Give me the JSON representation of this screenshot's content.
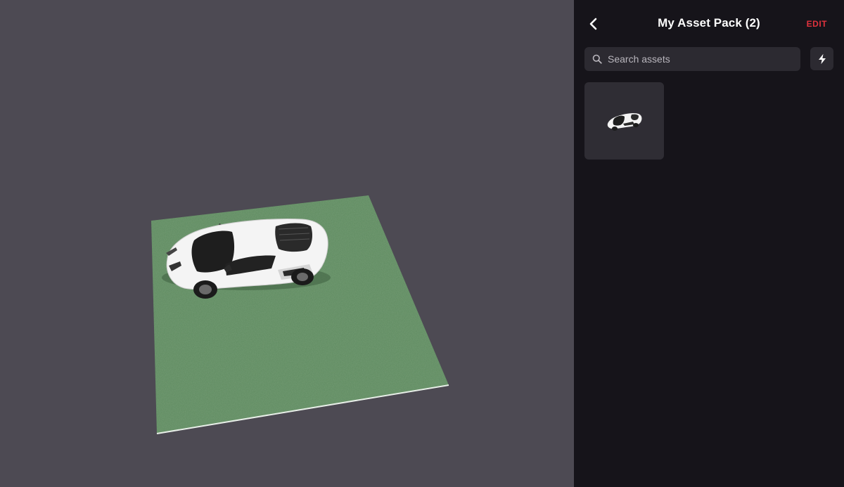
{
  "panel": {
    "title": "My Asset Pack (2)",
    "edit_label": "EDIT",
    "back_icon": "chevron-left-icon",
    "accent_color": "#e0323d"
  },
  "search": {
    "placeholder": "Search assets",
    "value": "",
    "icon": "search-icon"
  },
  "actions": {
    "bolt_icon": "lightning-bolt-icon"
  },
  "assets": [
    {
      "name": "white sports car",
      "icon": "car-thumbnail"
    }
  ],
  "scene": {
    "background_color": "#4d4a53",
    "ground_color": "#5e8a5f",
    "objects": [
      "ground-plane",
      "sports-car"
    ]
  }
}
